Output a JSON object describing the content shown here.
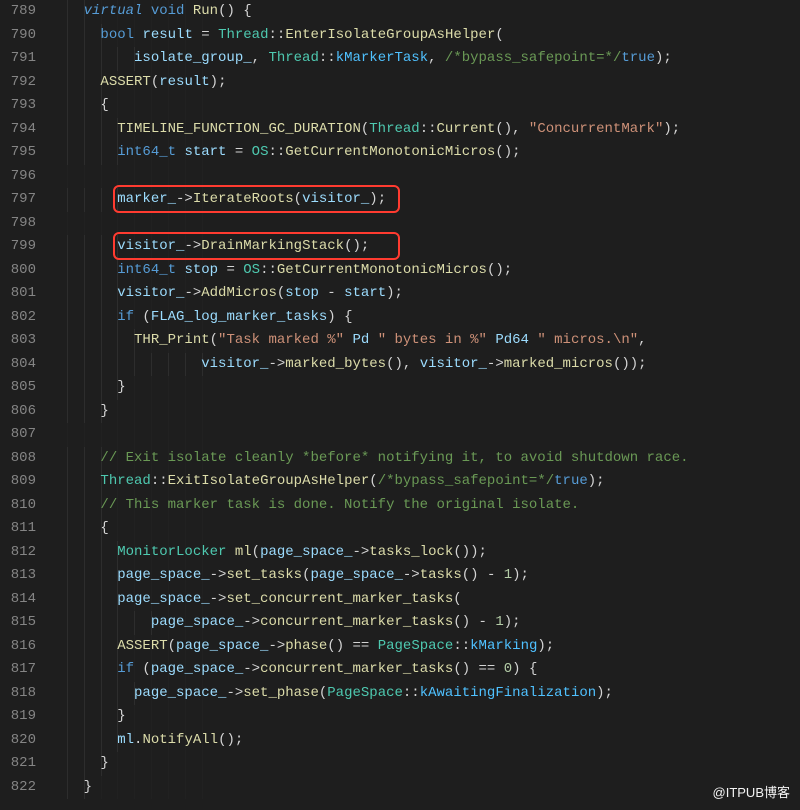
{
  "first_line_number": 789,
  "watermark": "@ITPUB博客",
  "lines": [
    {
      "indent": 2,
      "tokens": [
        [
          "kw",
          "virtual"
        ],
        [
          "op",
          " "
        ],
        [
          "kw2",
          "void"
        ],
        [
          "op",
          " "
        ],
        [
          "fn",
          "Run"
        ],
        [
          "punc",
          "() {"
        ]
      ]
    },
    {
      "indent": 3,
      "tokens": [
        [
          "kw2",
          "bool"
        ],
        [
          "op",
          " "
        ],
        [
          "var",
          "result"
        ],
        [
          "op",
          " = "
        ],
        [
          "type",
          "Thread"
        ],
        [
          "punc",
          "::"
        ],
        [
          "fn",
          "EnterIsolateGroupAsHelper"
        ],
        [
          "punc",
          "("
        ]
      ]
    },
    {
      "indent": 5,
      "tokens": [
        [
          "var",
          "isolate_group_"
        ],
        [
          "punc",
          ", "
        ],
        [
          "type",
          "Thread"
        ],
        [
          "punc",
          "::"
        ],
        [
          "const",
          "kMarkerTask"
        ],
        [
          "punc",
          ", "
        ],
        [
          "cmt",
          "/*bypass_safepoint=*/"
        ],
        [
          "kw2",
          "true"
        ],
        [
          "punc",
          ");"
        ]
      ]
    },
    {
      "indent": 3,
      "tokens": [
        [
          "macro",
          "ASSERT"
        ],
        [
          "punc",
          "("
        ],
        [
          "var",
          "result"
        ],
        [
          "punc",
          ");"
        ]
      ]
    },
    {
      "indent": 3,
      "tokens": [
        [
          "punc",
          "{"
        ]
      ]
    },
    {
      "indent": 4,
      "tokens": [
        [
          "macro",
          "TIMELINE_FUNCTION_GC_DURATION"
        ],
        [
          "punc",
          "("
        ],
        [
          "type",
          "Thread"
        ],
        [
          "punc",
          "::"
        ],
        [
          "fn",
          "Current"
        ],
        [
          "punc",
          "(), "
        ],
        [
          "str",
          "\"ConcurrentMark\""
        ],
        [
          "punc",
          ");"
        ]
      ]
    },
    {
      "indent": 4,
      "tokens": [
        [
          "kw2",
          "int64_t"
        ],
        [
          "op",
          " "
        ],
        [
          "var",
          "start"
        ],
        [
          "op",
          " = "
        ],
        [
          "type",
          "OS"
        ],
        [
          "punc",
          "::"
        ],
        [
          "fn",
          "GetCurrentMonotonicMicros"
        ],
        [
          "punc",
          "();"
        ]
      ]
    },
    {
      "indent": 0,
      "tokens": []
    },
    {
      "indent": 4,
      "tokens": [
        [
          "var",
          "marker_"
        ],
        [
          "op",
          "->"
        ],
        [
          "fn",
          "IterateRoots"
        ],
        [
          "punc",
          "("
        ],
        [
          "var",
          "visitor_"
        ],
        [
          "punc",
          ");"
        ]
      ]
    },
    {
      "indent": 0,
      "tokens": []
    },
    {
      "indent": 4,
      "tokens": [
        [
          "var",
          "visitor_"
        ],
        [
          "op",
          "->"
        ],
        [
          "fn",
          "DrainMarkingStack"
        ],
        [
          "punc",
          "();"
        ]
      ]
    },
    {
      "indent": 4,
      "tokens": [
        [
          "kw2",
          "int64_t"
        ],
        [
          "op",
          " "
        ],
        [
          "var",
          "stop"
        ],
        [
          "op",
          " = "
        ],
        [
          "type",
          "OS"
        ],
        [
          "punc",
          "::"
        ],
        [
          "fn",
          "GetCurrentMonotonicMicros"
        ],
        [
          "punc",
          "();"
        ]
      ]
    },
    {
      "indent": 4,
      "tokens": [
        [
          "var",
          "visitor_"
        ],
        [
          "op",
          "->"
        ],
        [
          "fn",
          "AddMicros"
        ],
        [
          "punc",
          "("
        ],
        [
          "var",
          "stop"
        ],
        [
          "op",
          " - "
        ],
        [
          "var",
          "start"
        ],
        [
          "punc",
          ");"
        ]
      ]
    },
    {
      "indent": 4,
      "tokens": [
        [
          "kw2",
          "if"
        ],
        [
          "op",
          " ("
        ],
        [
          "var",
          "FLAG_log_marker_tasks"
        ],
        [
          "punc",
          ") {"
        ]
      ]
    },
    {
      "indent": 5,
      "tokens": [
        [
          "fn",
          "THR_Print"
        ],
        [
          "punc",
          "("
        ],
        [
          "str",
          "\"Task marked %\""
        ],
        [
          "op",
          " "
        ],
        [
          "var",
          "Pd"
        ],
        [
          "op",
          " "
        ],
        [
          "str",
          "\" bytes in %\""
        ],
        [
          "op",
          " "
        ],
        [
          "var",
          "Pd64"
        ],
        [
          "op",
          " "
        ],
        [
          "str",
          "\" micros.\\n\""
        ],
        [
          "punc",
          ","
        ]
      ]
    },
    {
      "indent": 9,
      "tokens": [
        [
          "var",
          "visitor_"
        ],
        [
          "op",
          "->"
        ],
        [
          "fn",
          "marked_bytes"
        ],
        [
          "punc",
          "(), "
        ],
        [
          "var",
          "visitor_"
        ],
        [
          "op",
          "->"
        ],
        [
          "fn",
          "marked_micros"
        ],
        [
          "punc",
          "());"
        ]
      ]
    },
    {
      "indent": 4,
      "tokens": [
        [
          "punc",
          "}"
        ]
      ]
    },
    {
      "indent": 3,
      "tokens": [
        [
          "punc",
          "}"
        ]
      ]
    },
    {
      "indent": 0,
      "tokens": []
    },
    {
      "indent": 3,
      "tokens": [
        [
          "cmt",
          "// Exit isolate cleanly *before* notifying it, to avoid shutdown race."
        ]
      ]
    },
    {
      "indent": 3,
      "tokens": [
        [
          "type",
          "Thread"
        ],
        [
          "punc",
          "::"
        ],
        [
          "fn",
          "ExitIsolateGroupAsHelper"
        ],
        [
          "punc",
          "("
        ],
        [
          "cmt",
          "/*bypass_safepoint=*/"
        ],
        [
          "kw2",
          "true"
        ],
        [
          "punc",
          ");"
        ]
      ]
    },
    {
      "indent": 3,
      "tokens": [
        [
          "cmt",
          "// This marker task is done. Notify the original isolate."
        ]
      ]
    },
    {
      "indent": 3,
      "tokens": [
        [
          "punc",
          "{"
        ]
      ]
    },
    {
      "indent": 4,
      "tokens": [
        [
          "type",
          "MonitorLocker"
        ],
        [
          "op",
          " "
        ],
        [
          "fn",
          "ml"
        ],
        [
          "punc",
          "("
        ],
        [
          "var",
          "page_space_"
        ],
        [
          "op",
          "->"
        ],
        [
          "fn",
          "tasks_lock"
        ],
        [
          "punc",
          "());"
        ]
      ]
    },
    {
      "indent": 4,
      "tokens": [
        [
          "var",
          "page_space_"
        ],
        [
          "op",
          "->"
        ],
        [
          "fn",
          "set_tasks"
        ],
        [
          "punc",
          "("
        ],
        [
          "var",
          "page_space_"
        ],
        [
          "op",
          "->"
        ],
        [
          "fn",
          "tasks"
        ],
        [
          "punc",
          "() - "
        ],
        [
          "num",
          "1"
        ],
        [
          "punc",
          ");"
        ]
      ]
    },
    {
      "indent": 4,
      "tokens": [
        [
          "var",
          "page_space_"
        ],
        [
          "op",
          "->"
        ],
        [
          "fn",
          "set_concurrent_marker_tasks"
        ],
        [
          "punc",
          "("
        ]
      ]
    },
    {
      "indent": 6,
      "tokens": [
        [
          "var",
          "page_space_"
        ],
        [
          "op",
          "->"
        ],
        [
          "fn",
          "concurrent_marker_tasks"
        ],
        [
          "punc",
          "() - "
        ],
        [
          "num",
          "1"
        ],
        [
          "punc",
          ");"
        ]
      ]
    },
    {
      "indent": 4,
      "tokens": [
        [
          "macro",
          "ASSERT"
        ],
        [
          "punc",
          "("
        ],
        [
          "var",
          "page_space_"
        ],
        [
          "op",
          "->"
        ],
        [
          "fn",
          "phase"
        ],
        [
          "punc",
          "() == "
        ],
        [
          "type",
          "PageSpace"
        ],
        [
          "punc",
          "::"
        ],
        [
          "const",
          "kMarking"
        ],
        [
          "punc",
          ");"
        ]
      ]
    },
    {
      "indent": 4,
      "tokens": [
        [
          "kw2",
          "if"
        ],
        [
          "op",
          " ("
        ],
        [
          "var",
          "page_space_"
        ],
        [
          "op",
          "->"
        ],
        [
          "fn",
          "concurrent_marker_tasks"
        ],
        [
          "punc",
          "() == "
        ],
        [
          "num",
          "0"
        ],
        [
          "punc",
          ") {"
        ]
      ]
    },
    {
      "indent": 5,
      "tokens": [
        [
          "var",
          "page_space_"
        ],
        [
          "op",
          "->"
        ],
        [
          "fn",
          "set_phase"
        ],
        [
          "punc",
          "("
        ],
        [
          "type",
          "PageSpace"
        ],
        [
          "punc",
          "::"
        ],
        [
          "const",
          "kAwaitingFinalization"
        ],
        [
          "punc",
          ");"
        ]
      ]
    },
    {
      "indent": 4,
      "tokens": [
        [
          "punc",
          "}"
        ]
      ]
    },
    {
      "indent": 4,
      "tokens": [
        [
          "var",
          "ml"
        ],
        [
          "punc",
          "."
        ],
        [
          "fn",
          "NotifyAll"
        ],
        [
          "punc",
          "();"
        ]
      ]
    },
    {
      "indent": 3,
      "tokens": [
        [
          "punc",
          "}"
        ]
      ]
    },
    {
      "indent": 2,
      "tokens": [
        [
          "punc",
          "}"
        ]
      ]
    }
  ],
  "highlight_boxes": [
    {
      "line": 797,
      "left_chars": 8,
      "width_chars": 33
    },
    {
      "line": 799,
      "left_chars": 8,
      "width_chars": 33
    }
  ],
  "indent_guides": [
    1,
    2,
    3,
    4,
    5,
    6,
    7,
    8,
    9
  ]
}
